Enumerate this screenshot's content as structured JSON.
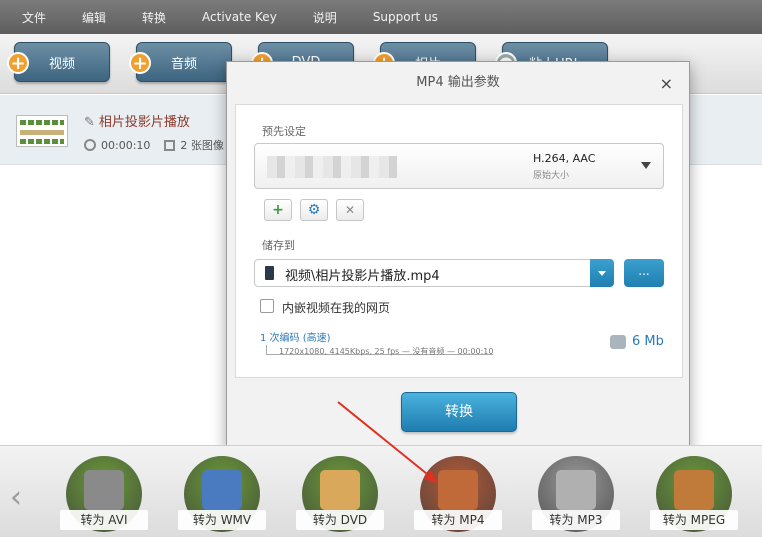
{
  "menu": [
    "文件",
    "编辑",
    "转换",
    "Activate Key",
    "说明",
    "Support us"
  ],
  "toolbar": {
    "buttons": [
      "视频",
      "音频",
      "DVD",
      "相片",
      "粘上URL"
    ]
  },
  "file": {
    "name": "相片投影片播放",
    "duration": "00:00:10",
    "images": "2 张图像"
  },
  "dialog": {
    "title": "MP4 输出参数",
    "close": "×",
    "preset_label": "预先设定",
    "preset_codec": "H.264, AAC",
    "preset_size": "原始大小",
    "save_label": "储存到",
    "save_path": "视频\\相片投影片播放.mp4",
    "browse": "...",
    "embed_label": "内嵌视频在我的网页",
    "encode_link": "1 次编码 (高速)",
    "encode_detail": "1720x1080, 4145Kbps, 25 fps — 没有音频 — 00:00:10",
    "file_size": "6 Mb",
    "convert": "转换",
    "add_icon": "+",
    "gear_icon": "⚙",
    "delete_icon": "✕"
  },
  "formats": [
    {
      "label": "转为 AVI",
      "color": "#6a9a3a",
      "glyph": "#8a8a8a"
    },
    {
      "label": "转为 WMV",
      "color": "#6a9a3a",
      "glyph": "#4a7ac0"
    },
    {
      "label": "转为 DVD",
      "color": "#6a9a3a",
      "glyph": "#d9a85a"
    },
    {
      "label": "转为 MP4",
      "color": "#b05a3a",
      "glyph": "#c06a3a"
    },
    {
      "label": "转为 MP3",
      "color": "#9a9a9a",
      "glyph": "#b0b0b0"
    },
    {
      "label": "转为 MPEG",
      "color": "#6a9a3a",
      "glyph": "#c07a3a"
    }
  ],
  "nav_prev": "‹"
}
